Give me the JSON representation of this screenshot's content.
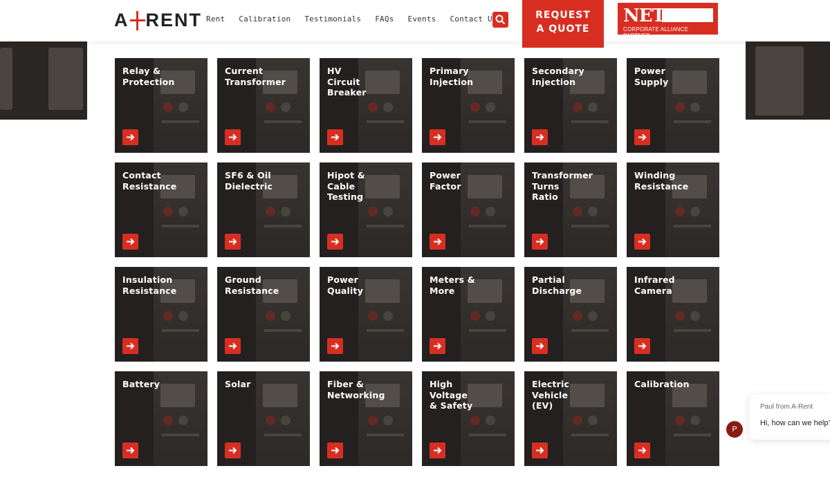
{
  "header": {
    "logo_left": "A",
    "logo_right": "RENT",
    "nav": [
      "Rent",
      "Calibration",
      "Testimonials",
      "FAQs",
      "Events",
      "Contact Us"
    ],
    "quote_button": "REQUEST\nA QUOTE",
    "neta": {
      "big": "NETA",
      "small": "CORPORATE ALLIANCE PARTNER"
    },
    "search_icon": "search-icon"
  },
  "colors": {
    "accent": "#d82e22",
    "tile_bg": "#242020"
  },
  "tiles": [
    {
      "title": "Relay &\nProtection"
    },
    {
      "title": "Current\nTransformer"
    },
    {
      "title": "HV\nCircuit\nBreaker"
    },
    {
      "title": "Primary\nInjection"
    },
    {
      "title": "Secondary\nInjection"
    },
    {
      "title": "Power\nSupply"
    },
    {
      "title": "Contact\nResistance"
    },
    {
      "title": "SF6 & Oil\nDielectric"
    },
    {
      "title": "Hipot &\nCable\nTesting"
    },
    {
      "title": "Power\nFactor"
    },
    {
      "title": "Transformer\nTurns\nRatio"
    },
    {
      "title": "Winding\nResistance"
    },
    {
      "title": "Insulation\nResistance"
    },
    {
      "title": "Ground\nResistance"
    },
    {
      "title": "Power\nQuality"
    },
    {
      "title": "Meters &\nMore"
    },
    {
      "title": "Partial\nDischarge"
    },
    {
      "title": "Infrared\nCamera"
    },
    {
      "title": "Battery"
    },
    {
      "title": "Solar"
    },
    {
      "title": "Fiber &\nNetworking"
    },
    {
      "title": "High\nVoltage\n& Safety"
    },
    {
      "title": "Electric\nVehicle\n(EV)"
    },
    {
      "title": "Calibration"
    }
  ],
  "chat": {
    "from": "Paul from A-Rent",
    "message": "Hi, how can we help?",
    "avatar_letter": "P"
  }
}
